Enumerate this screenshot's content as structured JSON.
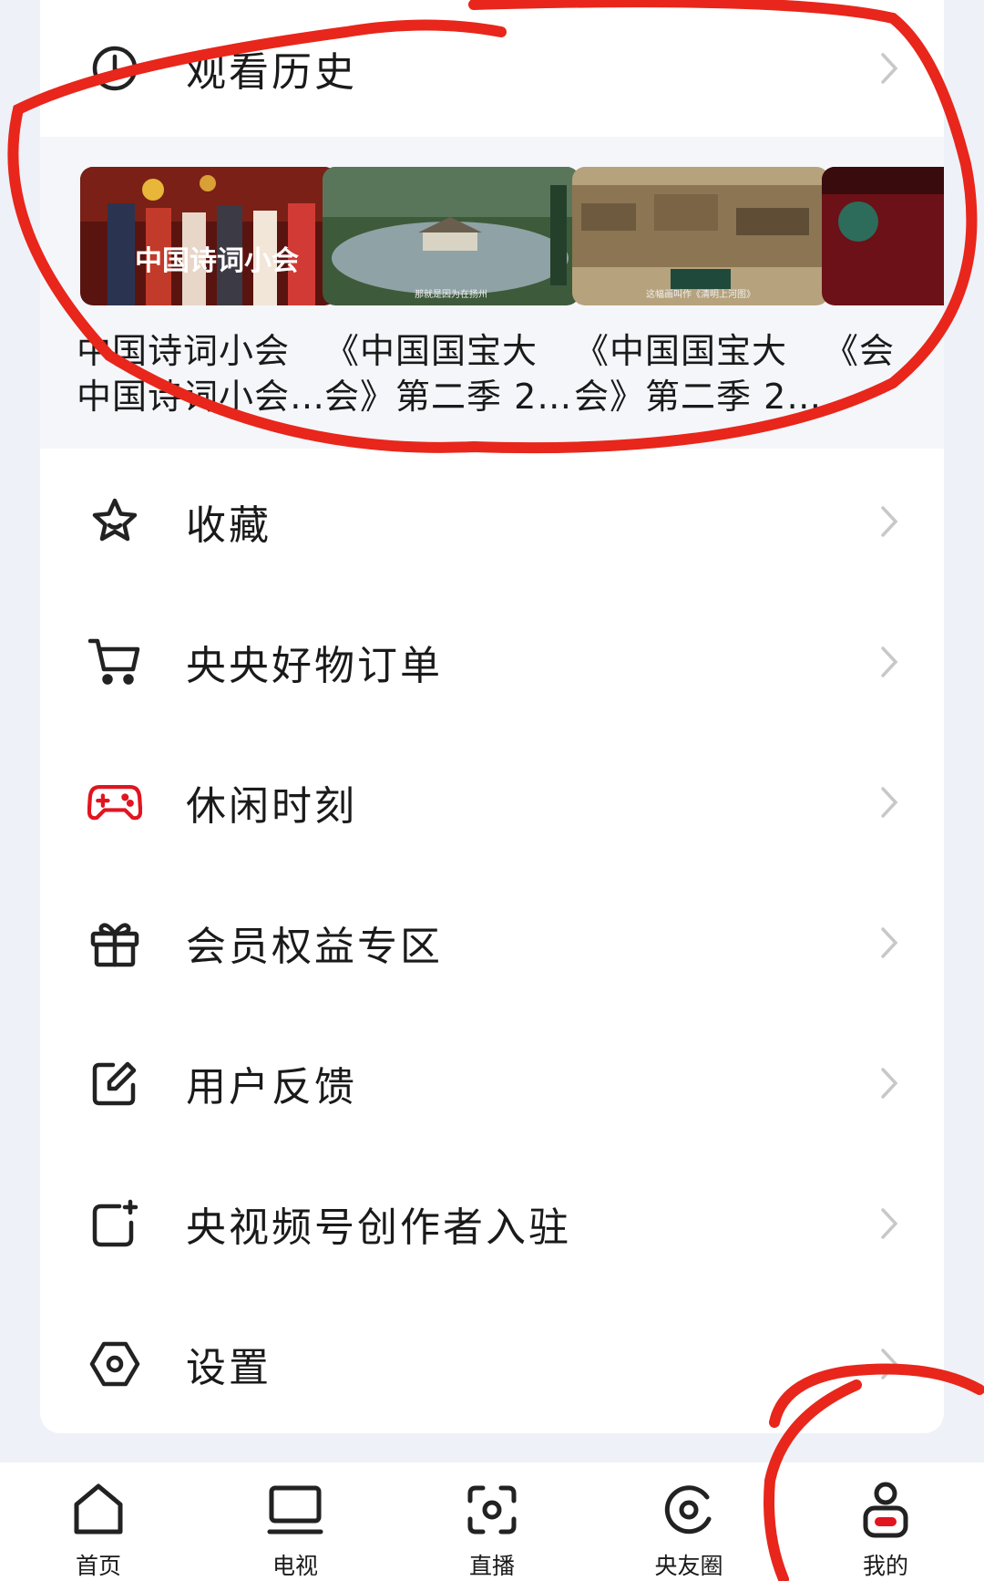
{
  "history": {
    "title": "观看历史",
    "items": [
      {
        "title": "中国诗词小会 中国诗词小会…",
        "thumb_overlay": "中国诗词小会"
      },
      {
        "title": "《中国国宝大会》第二季 2…",
        "thumb_caption": "那就是因为在扬州"
      },
      {
        "title": "《中国国宝大会》第二季 2…",
        "thumb_caption": "这幅画叫作《清明上河图》"
      },
      {
        "title": "《会"
      }
    ]
  },
  "menu": [
    {
      "label": "收藏",
      "icon": "star-icon"
    },
    {
      "label": "央央好物订单",
      "icon": "cart-icon"
    },
    {
      "label": "休闲时刻",
      "icon": "gamepad-icon"
    },
    {
      "label": "会员权益专区",
      "icon": "gift-icon"
    },
    {
      "label": "用户反馈",
      "icon": "edit-icon"
    },
    {
      "label": "央视频号创作者入驻",
      "icon": "creator-icon"
    },
    {
      "label": "设置",
      "icon": "settings-icon"
    }
  ],
  "tabbar": [
    {
      "label": "首页",
      "icon": "home-icon"
    },
    {
      "label": "电视",
      "icon": "tv-icon"
    },
    {
      "label": "直播",
      "icon": "live-icon"
    },
    {
      "label": "央友圈",
      "icon": "circle-icon"
    },
    {
      "label": "我的",
      "icon": "profile-icon",
      "active": true
    }
  ],
  "colors": {
    "accent": "#e0151f",
    "annotation": "#e8261b",
    "background": "#eef1f7"
  }
}
